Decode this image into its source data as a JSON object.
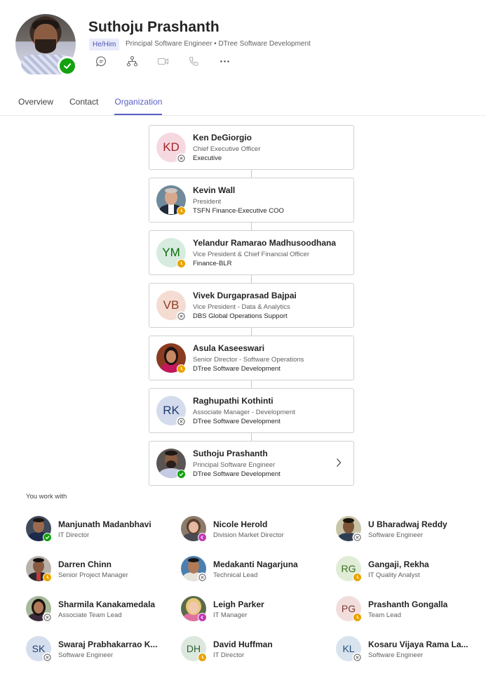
{
  "profile": {
    "name": "Suthoju Prashanth",
    "pronouns": "He/Him",
    "subtitle": "Principal Software Engineer • DTree Software Development",
    "status": "available",
    "actions": [
      {
        "icon": "chat-icon"
      },
      {
        "icon": "org-chart-icon"
      },
      {
        "icon": "video-call-icon"
      },
      {
        "icon": "phone-call-icon"
      },
      {
        "icon": "more-options-icon"
      }
    ]
  },
  "tabs": [
    {
      "label": "Overview",
      "active": false
    },
    {
      "label": "Contact",
      "active": false
    },
    {
      "label": "Organization",
      "active": true
    }
  ],
  "org_chain": [
    {
      "name": "Ken DeGiorgio",
      "title": "Chief Executive Officer",
      "dept": "Executive",
      "initials": "KD",
      "avatar_bg": "#f6d9e0",
      "avatar_fg": "#a4262c",
      "status": "offline",
      "photo": false
    },
    {
      "name": "Kevin Wall",
      "title": "President",
      "dept": "TSFN Finance-Executive COO",
      "initials": "",
      "status": "away",
      "photo": true
    },
    {
      "name": "Yelandur Ramarao Madhusoodhana",
      "title": "Vice President & Chief Financial Officer",
      "dept": "Finance-BLR",
      "initials": "YM",
      "avatar_bg": "#d7ecdf",
      "avatar_fg": "#0b6a0b",
      "status": "away",
      "photo": false
    },
    {
      "name": "Vivek Durgaprasad Bajpai",
      "title": "Vice President - Data & Analytics",
      "dept": "DBS Global Operations Support",
      "initials": "VB",
      "avatar_bg": "#f4dcd3",
      "avatar_fg": "#8e3b24",
      "status": "offline",
      "photo": false
    },
    {
      "name": "Asula Kaseeswari",
      "title": "Senior Director - Software Operations",
      "dept": "DTree Software Development",
      "initials": "",
      "status": "away",
      "photo": true
    },
    {
      "name": "Raghupathi Kothinti",
      "title": "Associate Manager - Development",
      "dept": "DTree Software Development",
      "initials": "RK",
      "avatar_bg": "#d4dbec",
      "avatar_fg": "#1f3c72",
      "status": "offline",
      "photo": false
    },
    {
      "name": "Suthoju Prashanth",
      "title": "Principal Software Engineer",
      "dept": "DTree Software Development",
      "initials": "",
      "status": "available",
      "photo": true,
      "expandable": true
    }
  ],
  "you_work_with": {
    "label": "You work with",
    "people": [
      {
        "name": "Manjunath Madanbhavi",
        "role": "IT Director",
        "initials": "",
        "status": "available",
        "photo": true
      },
      {
        "name": "Nicole Herold",
        "role": "Division Market Director",
        "initials": "",
        "status": "oof",
        "photo": true
      },
      {
        "name": "U Bharadwaj Reddy",
        "role": "Software Engineer",
        "initials": "",
        "status": "offline",
        "photo": true
      },
      {
        "name": "Darren Chinn",
        "role": "Senior Project Manager",
        "initials": "",
        "status": "away",
        "photo": true
      },
      {
        "name": "Medakanti Nagarjuna",
        "role": "Technical Lead",
        "initials": "",
        "status": "offline",
        "photo": true
      },
      {
        "name": "Gangaji, Rekha",
        "role": "IT Quality Analyst",
        "initials": "RG",
        "avatar_bg": "#e0ecd6",
        "avatar_fg": "#3b6d20",
        "status": "away",
        "photo": false
      },
      {
        "name": "Sharmila Kanakamedala",
        "role": "Associate Team Lead",
        "initials": "",
        "status": "offline",
        "photo": true
      },
      {
        "name": "Leigh Parker",
        "role": "IT Manager",
        "initials": "",
        "status": "oof",
        "photo": true
      },
      {
        "name": "Prashanth Gongalla",
        "role": "Team Lead",
        "initials": "PG",
        "avatar_bg": "#f1dedc",
        "avatar_fg": "#7a3a30",
        "status": "away",
        "photo": false
      },
      {
        "name": "Swaraj Prabhakarrao K...",
        "role": "Software Engineer",
        "initials": "SK",
        "avatar_bg": "#d5deed",
        "avatar_fg": "#1f3c72",
        "status": "offline",
        "photo": false
      },
      {
        "name": "David Huffman",
        "role": "IT Director",
        "initials": "DH",
        "avatar_bg": "#dce8de",
        "avatar_fg": "#2d5e35",
        "status": "away",
        "photo": false
      },
      {
        "name": "Kosaru Vijaya Rama La...",
        "role": "Software Engineer",
        "initials": "KL",
        "avatar_bg": "#d8e3ee",
        "avatar_fg": "#284e74",
        "status": "offline",
        "photo": false
      }
    ]
  },
  "colors": {
    "accent": "#5b5fc7",
    "available": "#13a10e",
    "away": "#eaa300",
    "oof": "#c239b3",
    "offline": "#8a8a8a"
  }
}
